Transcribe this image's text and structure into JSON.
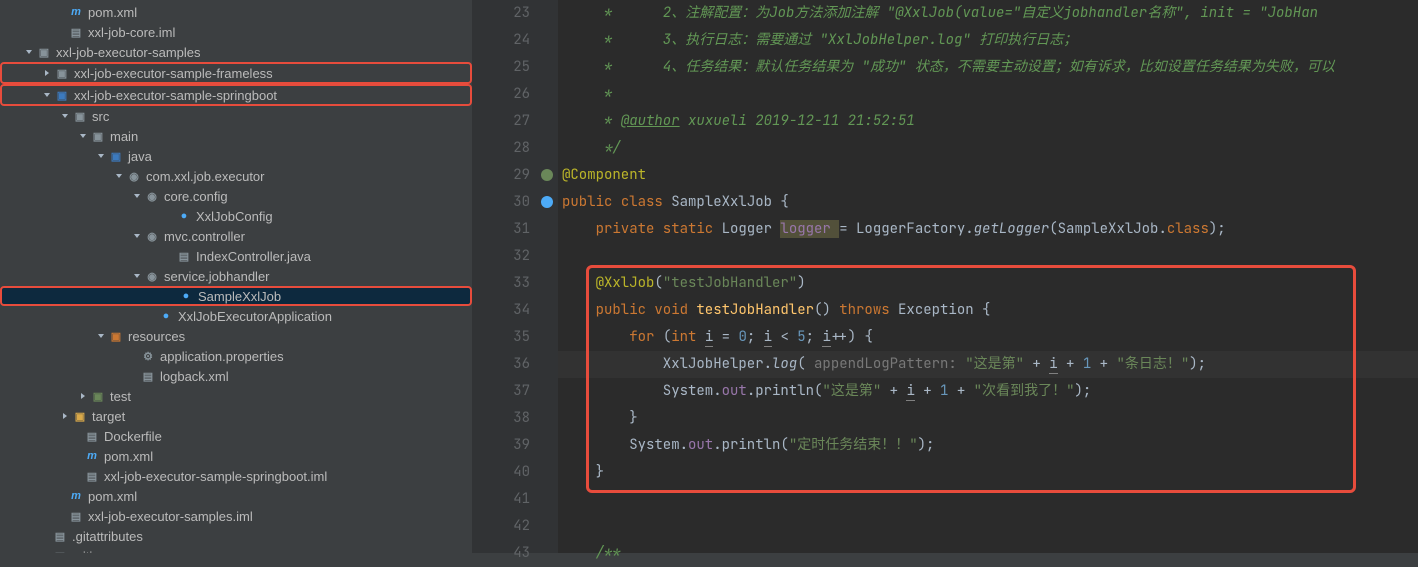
{
  "tree": {
    "items": [
      {
        "indent": 56,
        "arrow": "",
        "icon": "m",
        "iconClass": "m-ico",
        "label": "pom.xml",
        "classes": ""
      },
      {
        "indent": 56,
        "arrow": "",
        "icon": "▤",
        "iconClass": "fil",
        "label": "xxl-job-core.iml",
        "classes": ""
      },
      {
        "indent": 24,
        "arrow": "down",
        "icon": "▣",
        "iconClass": "fld",
        "label": "xxl-job-executor-samples",
        "classes": ""
      },
      {
        "indent": 40,
        "arrow": "right",
        "icon": "▣",
        "iconClass": "fld",
        "label": "xxl-job-executor-sample-frameless",
        "classes": "redbox"
      },
      {
        "indent": 40,
        "arrow": "down",
        "icon": "▣",
        "iconClass": "fld-src",
        "label": "xxl-job-executor-sample-springboot",
        "classes": "redbox"
      },
      {
        "indent": 60,
        "arrow": "down",
        "icon": "▣",
        "iconClass": "fld",
        "label": "src",
        "classes": ""
      },
      {
        "indent": 78,
        "arrow": "down",
        "icon": "▣",
        "iconClass": "fld",
        "label": "main",
        "classes": ""
      },
      {
        "indent": 96,
        "arrow": "down",
        "icon": "▣",
        "iconClass": "fld-src",
        "label": "java",
        "classes": ""
      },
      {
        "indent": 114,
        "arrow": "down",
        "icon": "◉",
        "iconClass": "pkg",
        "label": "com.xxl.job.executor",
        "classes": ""
      },
      {
        "indent": 132,
        "arrow": "down",
        "icon": "◉",
        "iconClass": "pkg",
        "label": "core.config",
        "classes": ""
      },
      {
        "indent": 164,
        "arrow": "",
        "icon": "●",
        "iconClass": "cls",
        "label": "XxlJobConfig",
        "classes": ""
      },
      {
        "indent": 132,
        "arrow": "down",
        "icon": "◉",
        "iconClass": "pkg",
        "label": "mvc.controller",
        "classes": ""
      },
      {
        "indent": 164,
        "arrow": "",
        "icon": "▤",
        "iconClass": "fil",
        "label": "IndexController.java",
        "classes": ""
      },
      {
        "indent": 132,
        "arrow": "down",
        "icon": "◉",
        "iconClass": "pkg",
        "label": "service.jobhandler",
        "classes": ""
      },
      {
        "indent": 164,
        "arrow": "",
        "icon": "●",
        "iconClass": "cls",
        "label": "SampleXxlJob",
        "classes": "selected redbox-inner"
      },
      {
        "indent": 146,
        "arrow": "",
        "icon": "●",
        "iconClass": "cls",
        "label": "XxlJobExecutorApplication",
        "classes": ""
      },
      {
        "indent": 96,
        "arrow": "down",
        "icon": "▣",
        "iconClass": "fld-res",
        "label": "resources",
        "classes": ""
      },
      {
        "indent": 128,
        "arrow": "",
        "icon": "⚙",
        "iconClass": "fil",
        "label": "application.properties",
        "classes": ""
      },
      {
        "indent": 128,
        "arrow": "",
        "icon": "▤",
        "iconClass": "fil",
        "label": "logback.xml",
        "classes": ""
      },
      {
        "indent": 78,
        "arrow": "right",
        "icon": "▣",
        "iconClass": "fld-test",
        "label": "test",
        "classes": ""
      },
      {
        "indent": 60,
        "arrow": "right",
        "icon": "▣",
        "iconClass": "fld-excl",
        "label": "target",
        "classes": ""
      },
      {
        "indent": 72,
        "arrow": "",
        "icon": "▤",
        "iconClass": "fil",
        "label": "Dockerfile",
        "classes": ""
      },
      {
        "indent": 72,
        "arrow": "",
        "icon": "m",
        "iconClass": "m-ico",
        "label": "pom.xml",
        "classes": ""
      },
      {
        "indent": 72,
        "arrow": "",
        "icon": "▤",
        "iconClass": "fil",
        "label": "xxl-job-executor-sample-springboot.iml",
        "classes": ""
      },
      {
        "indent": 56,
        "arrow": "",
        "icon": "m",
        "iconClass": "m-ico",
        "label": "pom.xml",
        "classes": ""
      },
      {
        "indent": 56,
        "arrow": "",
        "icon": "▤",
        "iconClass": "fil",
        "label": "xxl-job-executor-samples.iml",
        "classes": ""
      },
      {
        "indent": 40,
        "arrow": "",
        "icon": "▤",
        "iconClass": "fil",
        "label": ".gitattributes",
        "classes": ""
      },
      {
        "indent": 40,
        "arrow": "",
        "icon": "▤",
        "iconClass": "fil",
        "label": ".gitignore",
        "classes": ""
      }
    ]
  },
  "gutter": {
    "start": 23,
    "end": 43
  },
  "code": {
    "l23": {
      "pre": "     *      2、注解配置：为Job方法添加注解 \"@XxlJob(value=\"自定义jobhandler名称\", init = \"JobHan"
    },
    "l24": {
      "pre": "     *      3、执行日志：需要通过 \"XxlJobHelper.log\" 打印执行日志；"
    },
    "l25": {
      "pre": "     *      4、任务结果：默认任务结果为 \"成功\" 状态，不需要主动设置；如有诉求，比如设置任务结果为失败，可以"
    },
    "l26": {
      "pre": "     *"
    },
    "l27": {
      "a": "     * ",
      "b": "@author",
      "c": " xuxueli 2019-12-11 21:52:51"
    },
    "l28": {
      "pre": "     */"
    },
    "l29": {
      "ann": "@Component"
    },
    "l30": {
      "a": "public ",
      "b": "class ",
      "c": "SampleXxlJob ",
      "d": "{"
    },
    "l31": {
      "a": "    private static ",
      "b": "Logger ",
      "c": "logger ",
      "d": "= LoggerFactory.",
      "e": "getLogger",
      "f": "(SampleXxlJob.",
      "g": "class",
      "h": ");"
    },
    "l33": {
      "a": "    @XxlJob",
      "b": "(",
      "c": "\"testJobHandler\"",
      "d": ")"
    },
    "l34": {
      "a": "    public void ",
      "b": "testJobHandler",
      "c": "() ",
      "d": "throws ",
      "e": "Exception {"
    },
    "l35": {
      "a": "        for ",
      "b": "(",
      "c": "int ",
      "d": "i",
      "e": " = ",
      "f": "0",
      "g": "; ",
      "h": "i",
      "i": " < ",
      "j": "5",
      "k": "; ",
      "l": "i",
      "m": "++) {"
    },
    "l36": {
      "a": "            XxlJobHelper.",
      "b": "log",
      "c": "( ",
      "d": "appendLogPattern: ",
      "e": "\"这是第\" ",
      "f": "+ ",
      "g": "i",
      "h": " + ",
      "i": "1 ",
      "j": "+ ",
      "k": "\"条日志！\"",
      "l": ");"
    },
    "l37": {
      "a": "            System.",
      "b": "out",
      "c": ".println(",
      "d": "\"这是第\" ",
      "e": "+ ",
      "f": "i",
      "g": " + ",
      "h": "1 ",
      "i": "+ ",
      "j": "\"次看到我了！\"",
      "k": ");"
    },
    "l38": {
      "a": "        }"
    },
    "l39": {
      "a": "        System.",
      "b": "out",
      "c": ".println(",
      "d": "\"定时任务结束！！\"",
      "e": ");"
    },
    "l40": {
      "a": "    }"
    },
    "l43": {
      "a": "    /**"
    }
  }
}
